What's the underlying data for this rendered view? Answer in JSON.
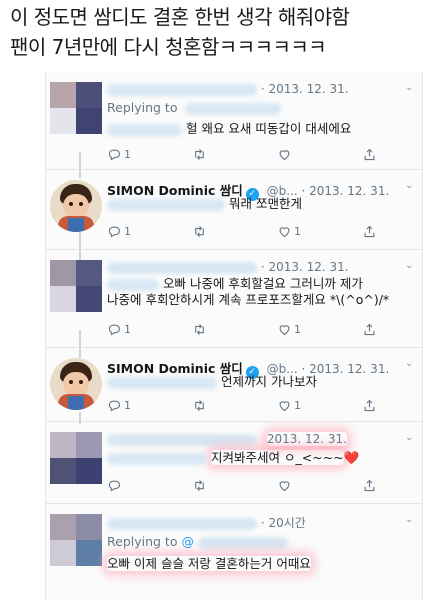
{
  "caption": {
    "line1": "이 정도면 쌈디도 결혼 한번 생각 해줘야함",
    "line2": "팬이 7년만에 다시 청혼함ㅋㅋㅋㅋㅋㅋ"
  },
  "tweets": [
    {
      "date": "· 2013. 12. 31.",
      "replying_label": "Replying to",
      "body": "헐 왜요 요새 띠동갑이 대세에요",
      "reply_count": "1",
      "like_count": ""
    },
    {
      "name": "SIMON Dominic 쌈디",
      "handle": "@b...",
      "date": "· 2013. 12. 31.",
      "body": "뭐래 쪼맨한게",
      "reply_count": "1",
      "like_count": "1"
    },
    {
      "date": "· 2013. 12. 31.",
      "body_line1": "오빠 나중에 후회할걸요 그러니까 제가",
      "body_line2": "나중에 후회안하시게 계속 프로포즈할게요 *\\(^o^)/*",
      "reply_count": "1",
      "like_count": "1"
    },
    {
      "name": "SIMON Dominic 쌈디",
      "handle": "@b...",
      "date": "· 2013. 12. 31.",
      "body": "언제까지 가나보자",
      "reply_count": "1",
      "like_count": "1"
    },
    {
      "date": "2013. 12. 31.",
      "body": "지켜봐주세여 ㅇ_<~~~",
      "heart_emoji": "❤️"
    },
    {
      "date": "· 20시간",
      "replying_label": "Replying to",
      "replying_handle": "@",
      "body": "오빠 이제 슬슬 저랑 결혼하는거 어때요"
    }
  ],
  "icons": {
    "reply": "reply-icon",
    "retweet": "retweet-icon",
    "like": "heart-icon",
    "share": "share-icon",
    "caret": "chevron-down-icon",
    "verified": "verified-badge-icon"
  },
  "colors": {
    "accent": "#1da1f2",
    "text_secondary": "#657786",
    "heart": "#e0245e"
  }
}
